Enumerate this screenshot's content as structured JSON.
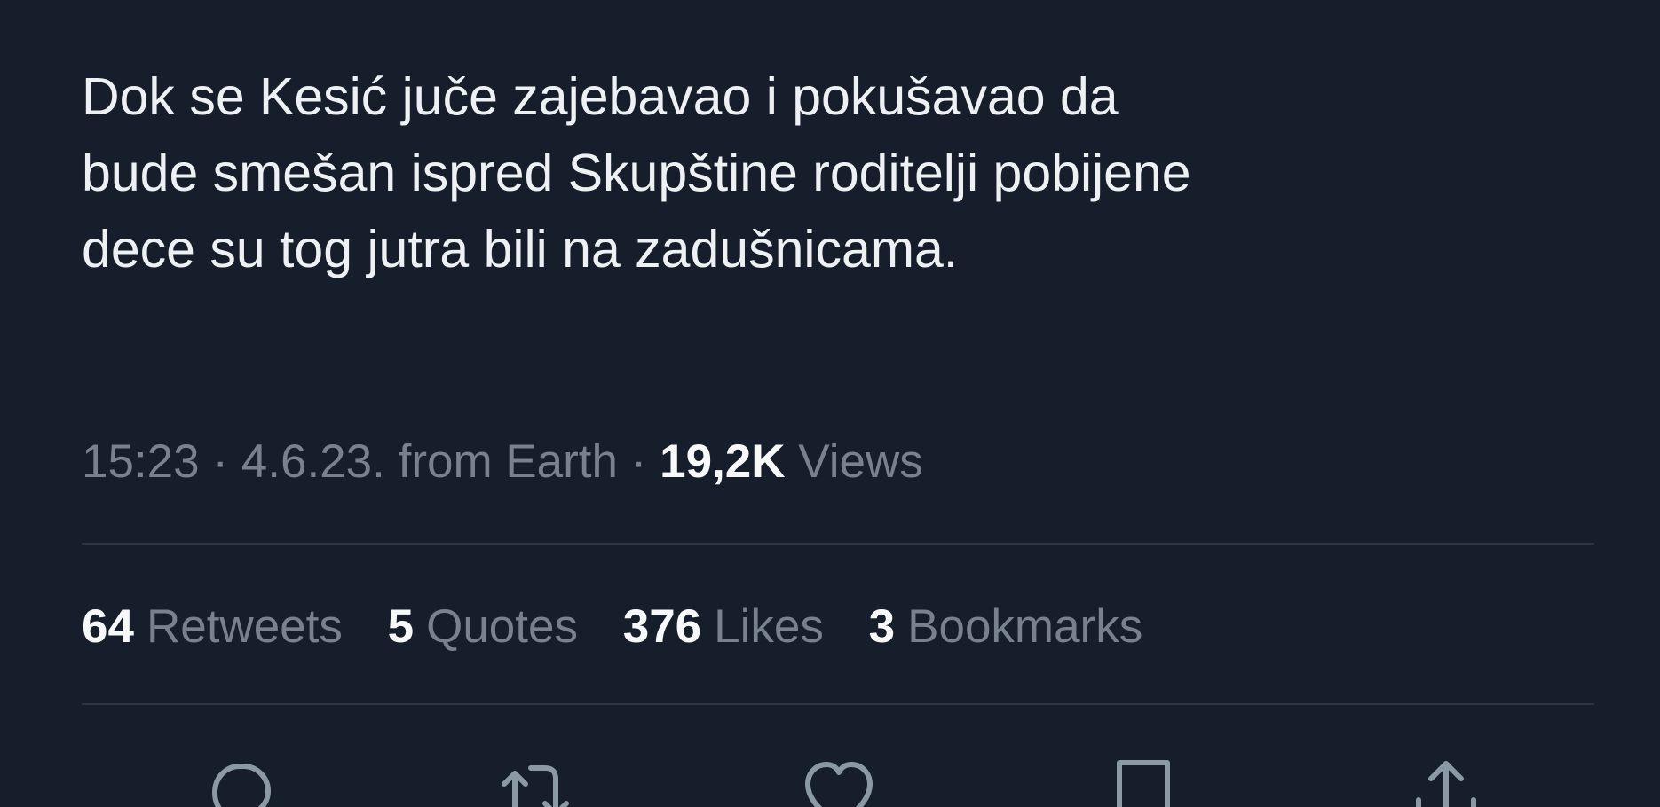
{
  "tweet": {
    "text_lines": [
      "Dok se Kesić juče zajebavao i pokušavao da",
      "bude smešan ispred Skupštine roditelji pobijene",
      "dece su tog jutra bili na zadušnicama."
    ],
    "time": "15:23",
    "date": "4.6.23.",
    "source": "from Earth",
    "separator": "·",
    "views_count": "19,2K",
    "views_label": "Views"
  },
  "stats": [
    {
      "count": "64",
      "label": "Retweets"
    },
    {
      "count": "5",
      "label": "Quotes"
    },
    {
      "count": "376",
      "label": "Likes"
    },
    {
      "count": "3",
      "label": "Bookmarks"
    }
  ],
  "actions": [
    {
      "icon": "reply-icon"
    },
    {
      "icon": "retweet-icon"
    },
    {
      "icon": "like-icon"
    },
    {
      "icon": "bookmark-icon"
    },
    {
      "icon": "share-icon"
    }
  ],
  "colors": {
    "background": "#161e2b",
    "text": "#eef1f3",
    "muted": "#78828e",
    "divider": "#2c3641",
    "icon": "#8b98a5"
  }
}
